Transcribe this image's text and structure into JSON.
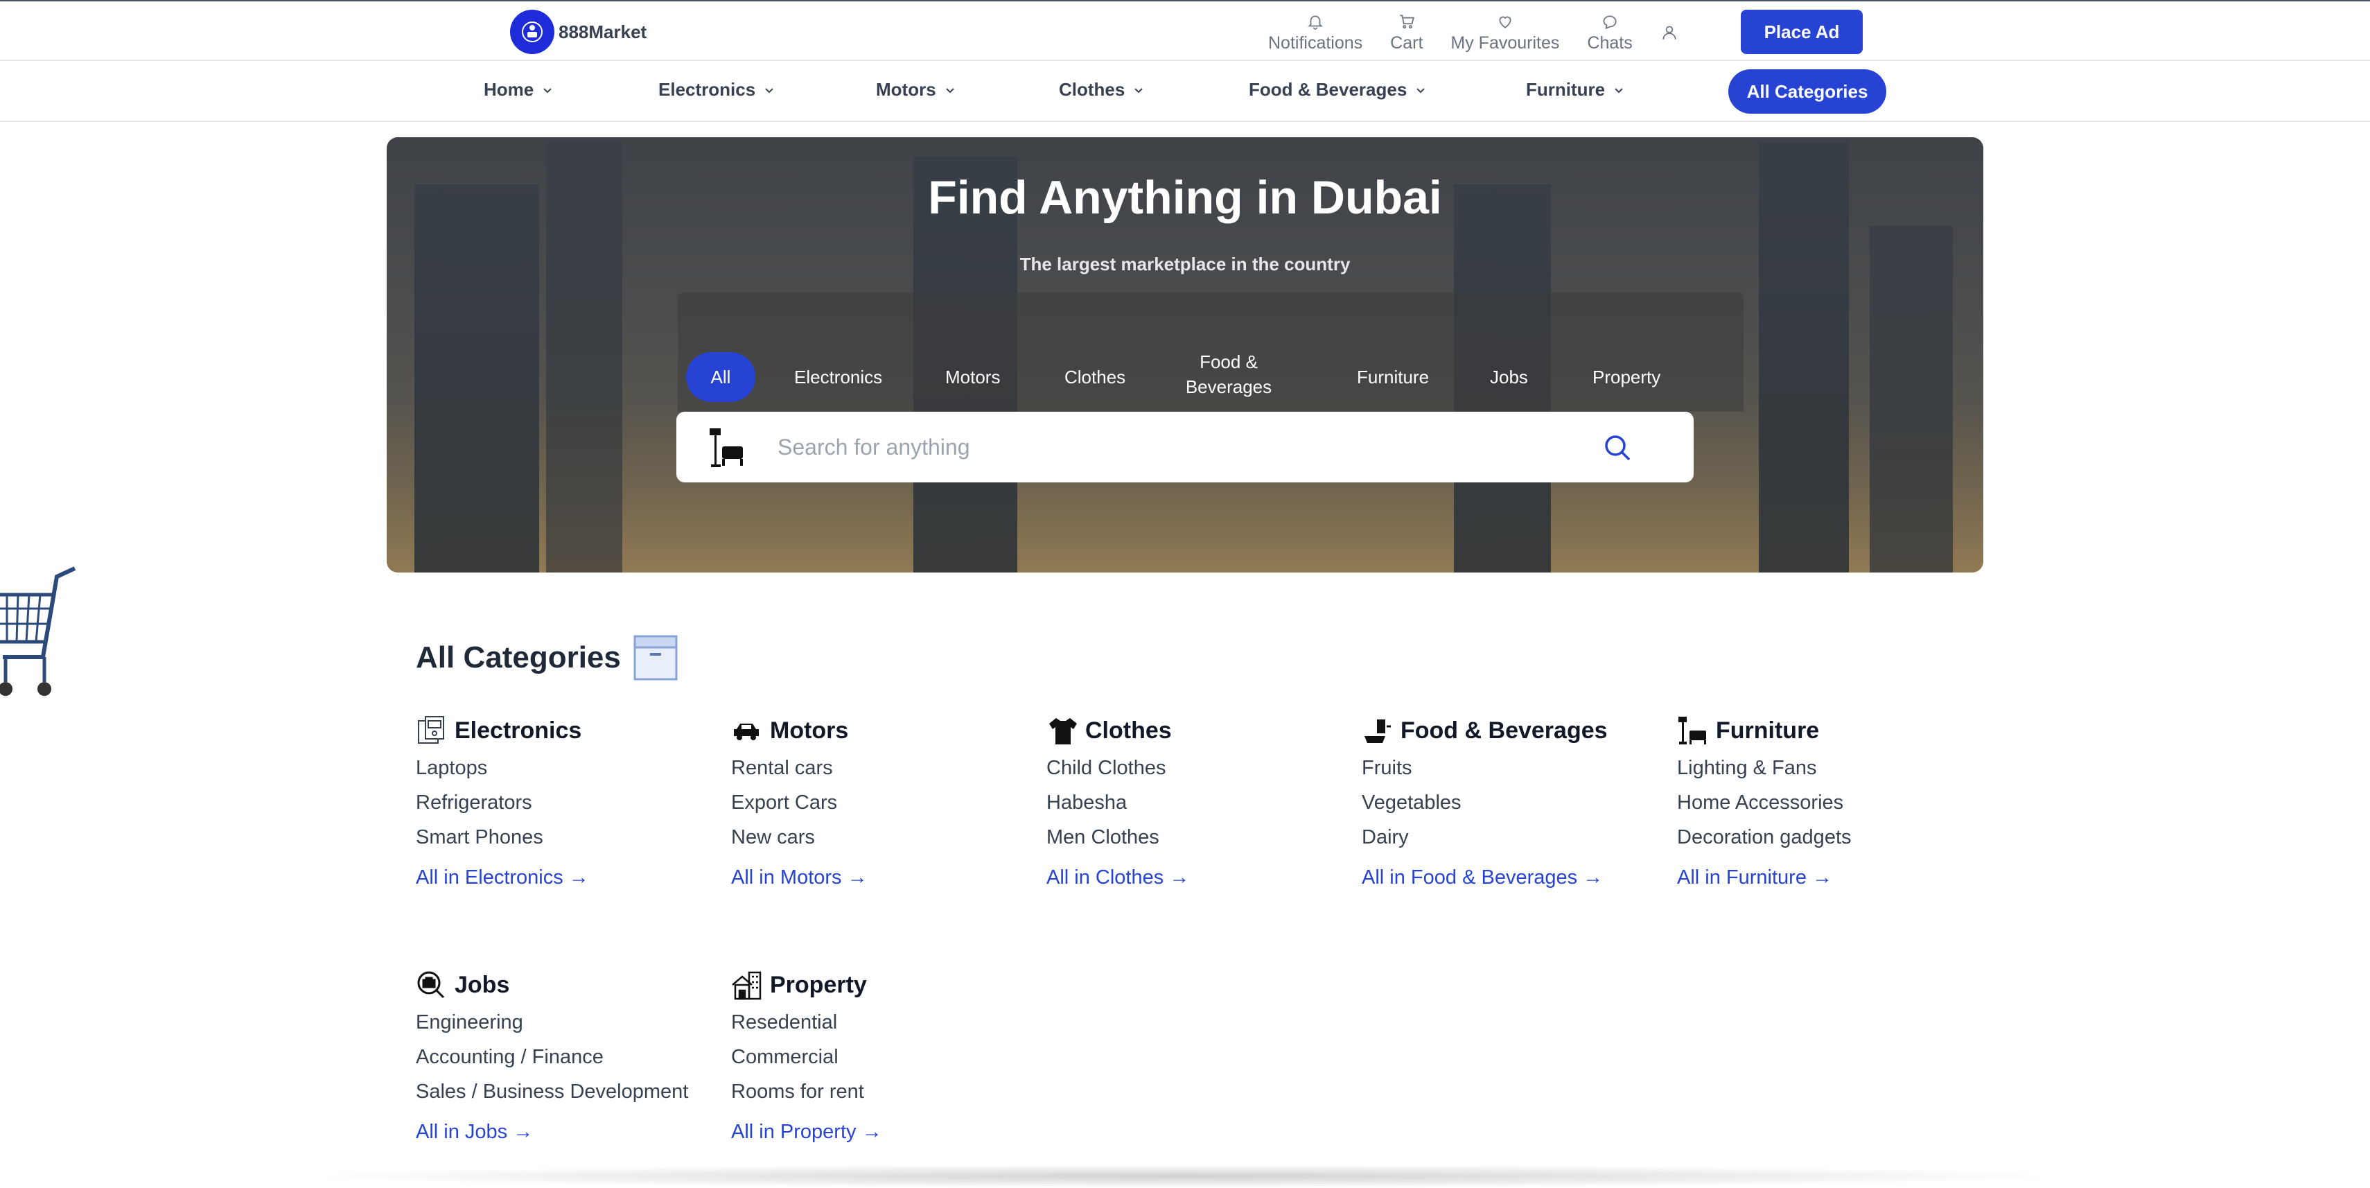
{
  "brand": {
    "name": "888Market"
  },
  "header": {
    "actions": [
      {
        "label": "Notifications",
        "icon": "bell-icon"
      },
      {
        "label": "Cart",
        "icon": "cart-icon"
      },
      {
        "label": "My Favourites",
        "icon": "heart-icon"
      },
      {
        "label": "Chats",
        "icon": "chat-icon"
      }
    ],
    "account_icon": "user-icon",
    "place_ad": "Place Ad"
  },
  "nav": {
    "items": [
      "Home",
      "Electronics",
      "Motors",
      "Clothes",
      "Food & Beverages",
      "Furniture"
    ],
    "all_categories": "All Categories"
  },
  "hero": {
    "title": "Find Anything in Dubai",
    "subtitle": "The largest marketplace in the country",
    "tabs": [
      "All",
      "Electronics",
      "Motors",
      "Clothes",
      "Food & Beverages",
      "Furniture",
      "Jobs",
      "Property"
    ],
    "active_tab": "All",
    "search_placeholder": "Search for anything"
  },
  "categories": {
    "title": "All Categories",
    "groups": [
      {
        "name": "Electronics",
        "icon": "electronics-icon",
        "links": [
          "Laptops",
          "Refrigerators",
          "Smart Phones"
        ],
        "all": "All in Electronics →"
      },
      {
        "name": "Motors",
        "icon": "car-icon",
        "links": [
          "Rental cars",
          "Export Cars",
          "New cars"
        ],
        "all": "All in Motors →"
      },
      {
        "name": "Clothes",
        "icon": "clothes-icon",
        "links": [
          "Child Clothes",
          "Habesha",
          "Men Clothes"
        ],
        "all": "All in Clothes →"
      },
      {
        "name": "Food & Beverages",
        "icon": "food-icon",
        "links": [
          "Fruits",
          "Vegetables",
          "Dairy"
        ],
        "all": "All in Food & Beverages →"
      },
      {
        "name": "Furniture",
        "icon": "furniture-icon",
        "links": [
          "Lighting & Fans",
          "Home Accessories",
          "Decoration gadgets"
        ],
        "all": "All in Furniture →"
      },
      {
        "name": "Jobs",
        "icon": "jobs-icon",
        "links": [
          "Engineering",
          "Accounting / Finance",
          "Sales / Business Development"
        ],
        "all": "All in Jobs →"
      },
      {
        "name": "Property",
        "icon": "property-icon",
        "links": [
          "Resedential",
          "Commercial",
          "Rooms for rent"
        ],
        "all": "All in Property →"
      }
    ]
  },
  "colors": {
    "accent": "#2743d3",
    "logo": "#1d2bd8",
    "text": "#1f2937",
    "muted": "#6b7280"
  }
}
